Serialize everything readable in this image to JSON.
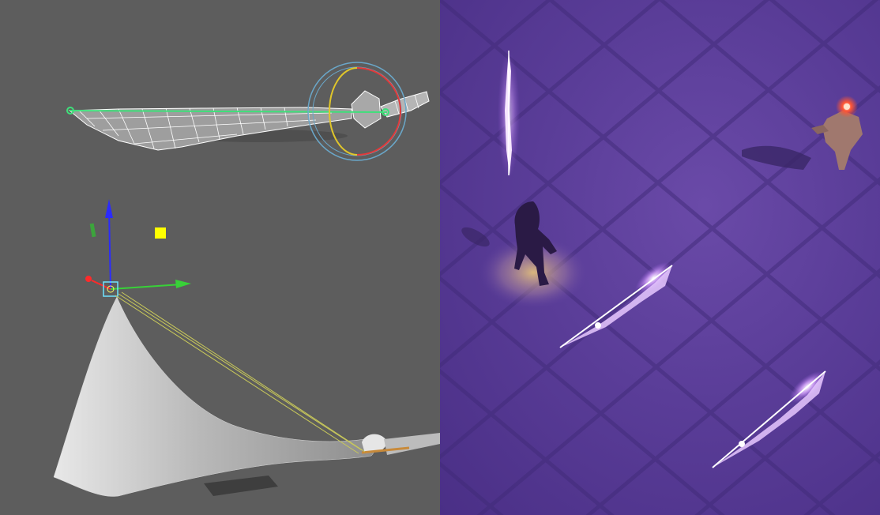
{
  "scene": {
    "left_view": "3d-modeling-viewport",
    "right_view": "game-render-preview"
  },
  "colors": {
    "viewport_bg": "#5d5d5d",
    "mesh_wire": "#ffffff",
    "mesh_fill": "#bdbdbd",
    "selection_green": "#3ee07a",
    "rotate_ring_outer": "#6aa7c9",
    "rotate_ring_red": "#e23a3a",
    "rotate_ring_yellow": "#e0c62a",
    "axis_x": "#38d138",
    "axis_y": "#2b2bff",
    "axis_z": "#ff2a2a",
    "pivot_yellow": "#ffff00",
    "dungeon_floor": "#5a3d98",
    "magic_glow": "#f3d7ff",
    "torch_light": "#d2b06a",
    "enemy_eye": "#ff5533"
  },
  "icons": {
    "move_gizmo": "move-gizmo-icon",
    "rotate_gizmo": "rotate-gizmo-icon",
    "pivot": "pivot-icon"
  }
}
